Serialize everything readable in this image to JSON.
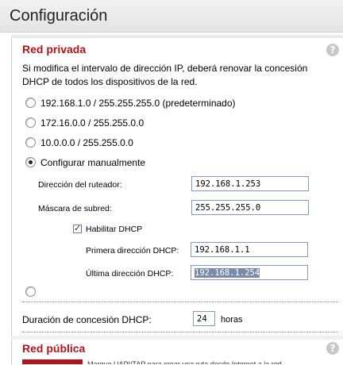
{
  "header": {
    "title": "Configuración"
  },
  "private_network": {
    "title": "Red privada",
    "help": "?",
    "description": "Si modifica el intervalo de dirección IP, deberá renovar la concesión DHCP de todos los dispositivos de la red.",
    "options": [
      {
        "label": "192.168.1.0 / 255.255.255.0 (predeterminado)",
        "checked": false
      },
      {
        "label": "172.16.0.0 / 255.255.0.0",
        "checked": false
      },
      {
        "label": "10.0.0.0 / 255.255.0.0",
        "checked": false
      },
      {
        "label": "Configurar manualmente",
        "checked": true
      },
      {
        "label": "",
        "checked": false
      }
    ],
    "router_address": {
      "label": "Dirección del ruteador:",
      "value": "192.168.1.253"
    },
    "subnet_mask": {
      "label": "Máscara de subred:",
      "value": "255.255.255.0"
    },
    "enable_dhcp": {
      "label": "Habilitar DHCP",
      "checked": true
    },
    "first_dhcp": {
      "label": "Primera dirección DHCP:",
      "value": "192.168.1.1"
    },
    "last_dhcp": {
      "label": "Última dirección DHCP:",
      "value": "192.168.1.254"
    },
    "lease": {
      "label": "Duración de concesión DHCP:",
      "value": "24",
      "unit": "horas"
    }
  },
  "public_network": {
    "title": "Red pública",
    "help": "?",
    "partial_text": "Marque UAPI/TAP para crear una ruta desde Internet a la red"
  },
  "colors": {
    "accent": "#b5121b"
  }
}
